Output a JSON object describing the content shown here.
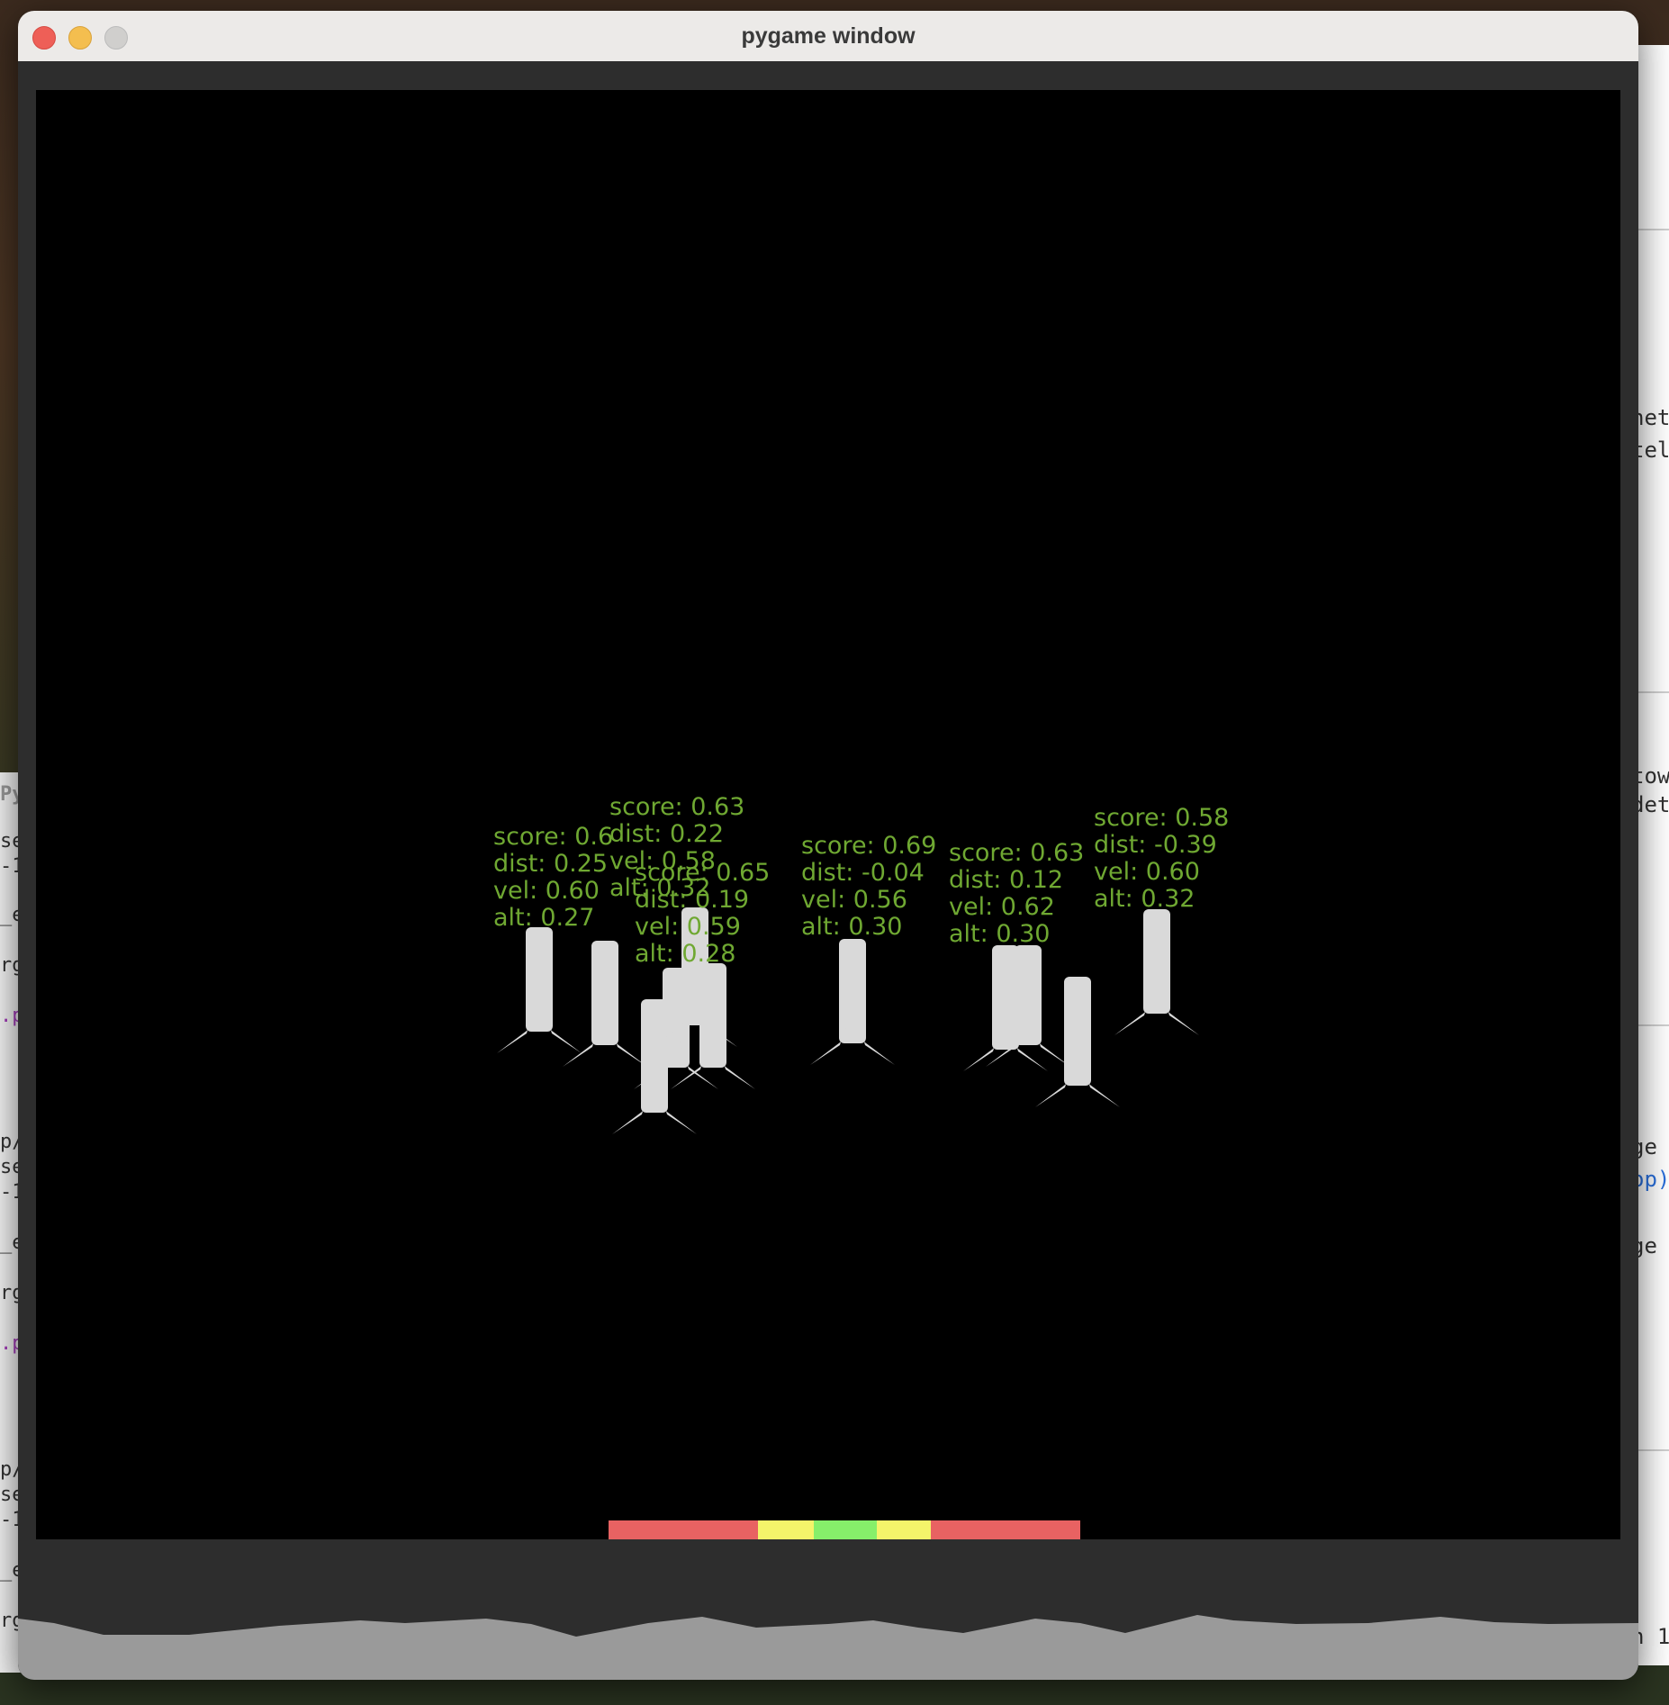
{
  "window": {
    "title": "pygame window"
  },
  "colors": {
    "screen_bg": "#000000",
    "frame_bg": "#2d2d2d",
    "terrain": "#9a9a9a",
    "rocket": "#d9d9d9",
    "label": "#6fa832",
    "pad_red": "#e86262",
    "pad_yellow": "#f4f46a",
    "pad_green": "#86ef6a"
  },
  "landing_pad": {
    "segments": [
      {
        "zone": "red",
        "color": "#e86262"
      },
      {
        "zone": "yellow",
        "color": "#f4f46a"
      },
      {
        "zone": "green",
        "color": "#86ef6a"
      },
      {
        "zone": "yellow",
        "color": "#f4f46a"
      },
      {
        "zone": "red",
        "color": "#e86262"
      }
    ]
  },
  "rockets": [
    {
      "labels": [
        "score: 0.63",
        "dist: 0.22",
        "vel: 0.58",
        "alt: 0.32"
      ]
    },
    {
      "labels": [
        "score: 0.65",
        "dist: 0.19",
        "vel: 0.59",
        "alt: 0.28"
      ]
    },
    {
      "labels": [
        "score: 0.6",
        "dist: 0.25",
        "vel: 0.60",
        "alt: 0.27"
      ]
    },
    {
      "labels": [
        "score: 0.69",
        "dist: -0.04",
        "vel: 0.56",
        "alt: 0.30"
      ]
    },
    {
      "labels": [
        "score: 0.63",
        "dist: 0.12",
        "vel: 0.62",
        "alt: 0.30"
      ]
    },
    {
      "labels": [
        "score: 0.58",
        "dist: -0.39",
        "vel: 0.60",
        "alt: 0.32"
      ]
    }
  ],
  "background_left": {
    "title_fragment": "Py",
    "lines": [
      "se",
      "-1",
      "_e",
      "rg",
      ".p",
      "p/",
      "se",
      "-1",
      "_e",
      "rg",
      ".p",
      "p/",
      "se",
      "-1",
      "_e",
      "rg"
    ]
  },
  "background_right": {
    "lines": [
      "net",
      "tel",
      "tow",
      "det",
      "ge",
      "op)",
      "ge",
      "n 1"
    ]
  }
}
